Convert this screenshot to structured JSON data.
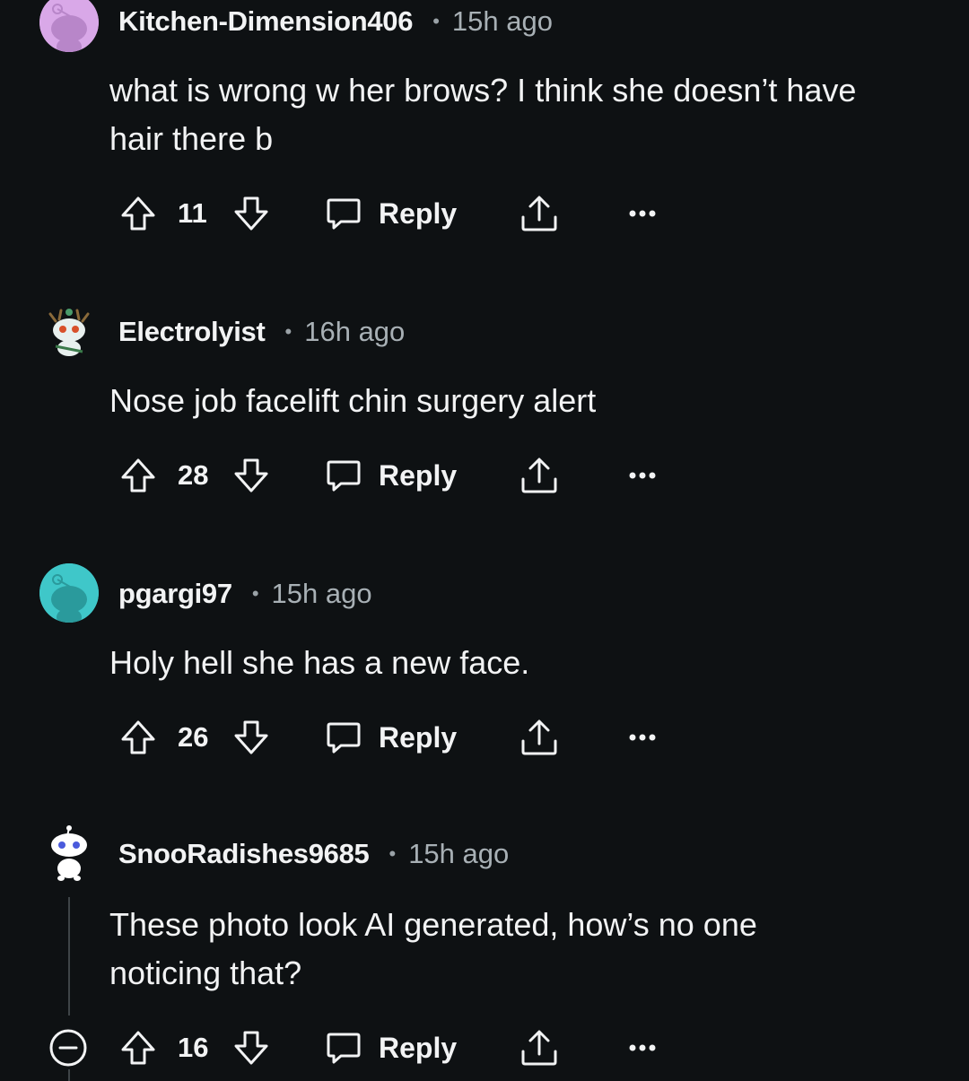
{
  "comments": [
    {
      "username": "Kitchen-Dimension406",
      "separator": "•",
      "time": "15h ago",
      "lines": [
        "what is wrong w her brows? I think she doesn’t have",
        "hair there b"
      ],
      "score": "11",
      "reply_label": "Reply",
      "avatar_color": "#d9a8e8"
    },
    {
      "username": "Electrolyist",
      "separator": "•",
      "time": "16h ago",
      "lines": [
        "Nose job facelift chin surgery alert"
      ],
      "score": "28",
      "reply_label": "Reply",
      "avatar_color": "#e8f0ee"
    },
    {
      "username": "pgargi97",
      "separator": "•",
      "time": "15h ago",
      "lines": [
        "Holy hell she has a new face."
      ],
      "score": "26",
      "reply_label": "Reply",
      "avatar_color": "#3fc7c9"
    },
    {
      "username": "SnooRadishes9685",
      "separator": "•",
      "time": "15h ago",
      "lines": [
        "These photo look AI generated, how’s no one",
        "noticing that?"
      ],
      "score": "16",
      "reply_label": "Reply",
      "avatar_color": "#ffffff"
    }
  ],
  "colors": {
    "background": "#0e1113",
    "text": "#f2f3f4",
    "muted": "#a8b0b5",
    "thread_line": "#3e4447"
  },
  "icons": {
    "upvote": "upvote-arrow-icon",
    "downvote": "downvote-arrow-icon",
    "reply": "chat-bubble-icon",
    "share": "share-icon",
    "more": "ellipsis-icon",
    "collapse": "minus-circle-icon"
  }
}
